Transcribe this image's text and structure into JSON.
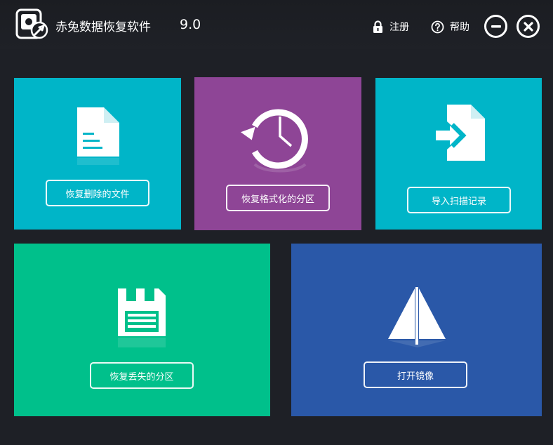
{
  "app": {
    "title": "赤兔数据恢复软件",
    "version": "9.0"
  },
  "header": {
    "register_label": "注册",
    "help_label": "帮助"
  },
  "tiles": [
    {
      "id": "recover-deleted",
      "button_label": "恢复删除的文件",
      "color": "#00b5c8"
    },
    {
      "id": "recover-formatted",
      "button_label": "恢复格式化的分区",
      "color": "#8e4596"
    },
    {
      "id": "import-scan",
      "button_label": "导入扫描记录",
      "color": "#00b5c8"
    },
    {
      "id": "recover-lost",
      "button_label": "恢复丢失的分区",
      "color": "#00c08b"
    },
    {
      "id": "open-image",
      "button_label": "打开镜像",
      "color": "#2a58a8"
    }
  ],
  "colors": {
    "background": "#1e2026",
    "titlebar": "#1c1e23",
    "icon": "#ffffff"
  },
  "icons": {
    "logo": "hard-drive-tool-icon",
    "register": "lock-icon",
    "help": "question-circle-icon",
    "minimize": "minus-circle-icon",
    "close": "x-circle-icon",
    "recover_deleted": "document-icon",
    "recover_formatted": "history-clock-icon",
    "import_scan": "import-file-icon",
    "recover_lost": "floppy-disk-icon",
    "open_image": "sail-triangle-icon"
  }
}
